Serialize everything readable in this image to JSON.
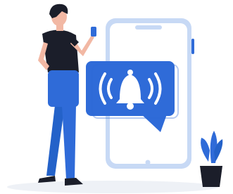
{
  "illustration": {
    "subject": "notification-bell-illustration",
    "icons": {
      "bell": "bell-icon",
      "sound_waves": "sound-waves-icon",
      "phone": "smartphone-icon",
      "plant": "potted-plant-icon"
    },
    "colors": {
      "primary_blue": "#2f6bd8",
      "light_blue": "#c7d9f5",
      "phone_screen": "#ffffff",
      "shadow": "#eef1f6",
      "hair": "#1b1e2a",
      "skin": "#f2b8a4",
      "shirt": "#1b1e2a",
      "pants": "#2f6bd8",
      "pot": "#1b1e2a",
      "white": "#ffffff"
    }
  }
}
